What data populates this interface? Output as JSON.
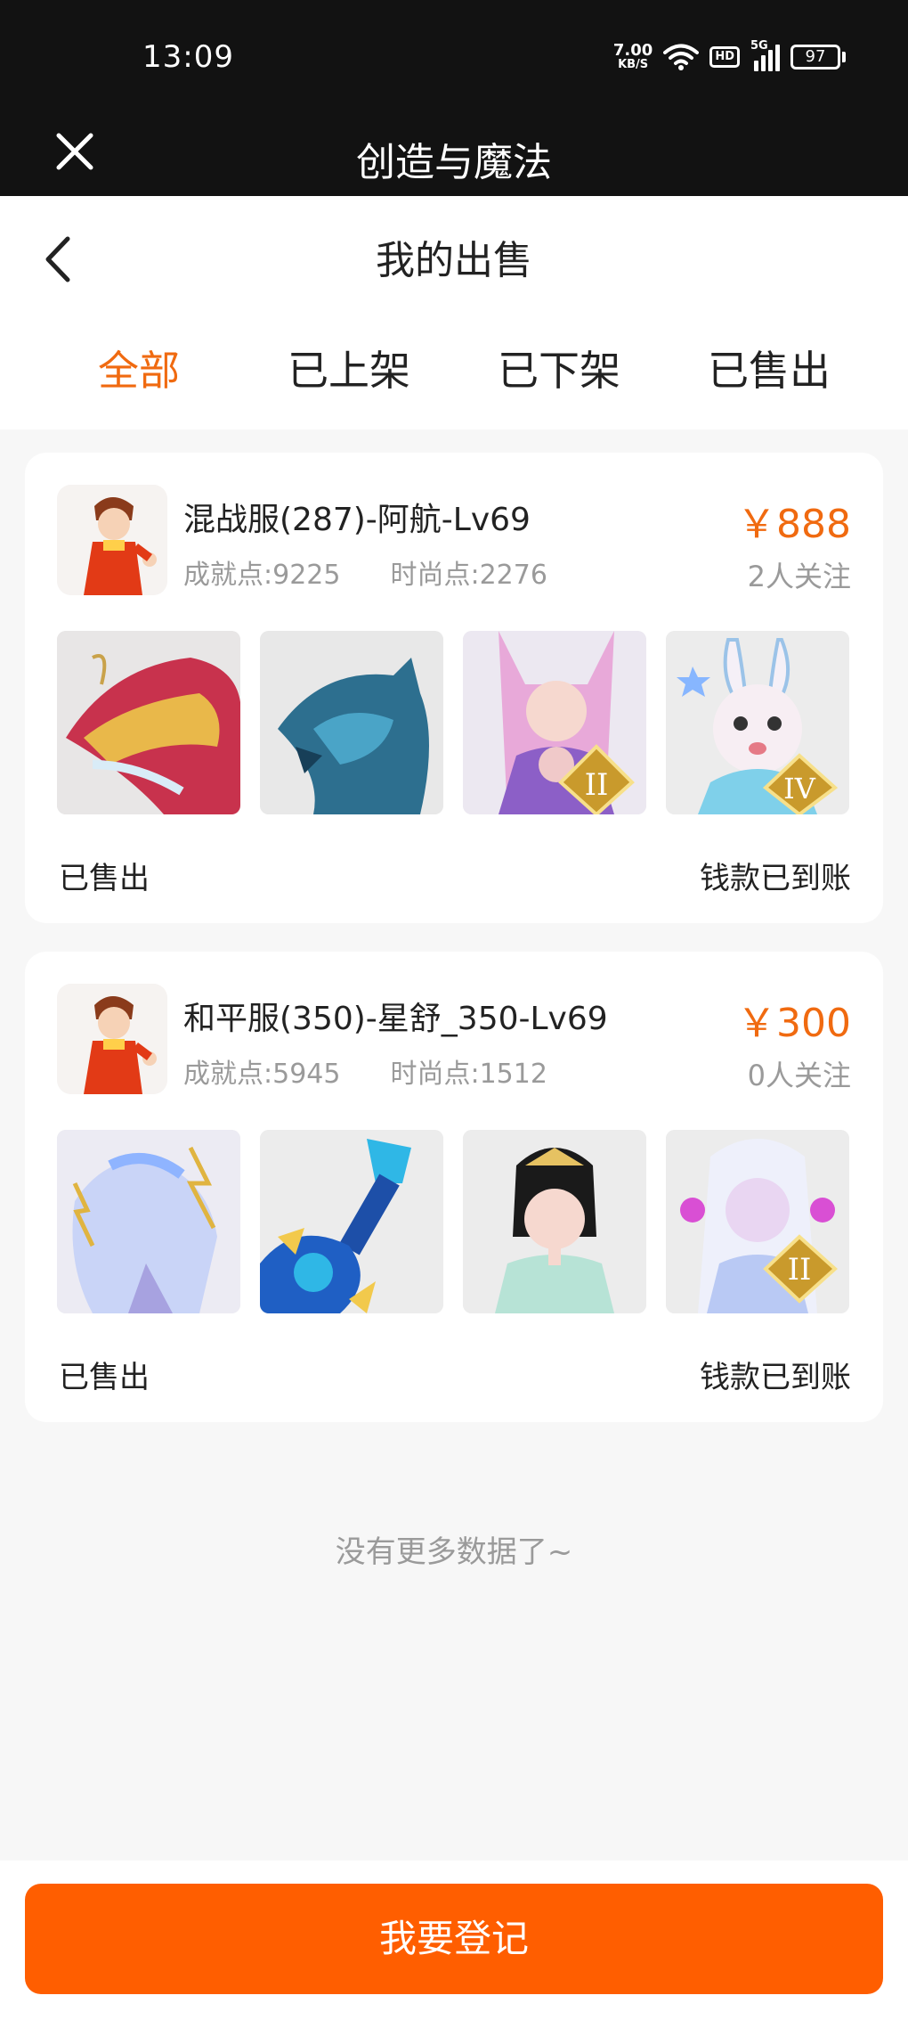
{
  "status_bar": {
    "time": "13:09",
    "net_speed_value": "7.00",
    "net_speed_unit": "KB/S",
    "hd_badge": "HD",
    "signal_label": "5G",
    "battery": "97"
  },
  "app_bar": {
    "title": "创造与魔法"
  },
  "page": {
    "title": "我的出售"
  },
  "tabs": [
    {
      "label": "全部",
      "active": true
    },
    {
      "label": "已上架",
      "active": false
    },
    {
      "label": "已下架",
      "active": false
    },
    {
      "label": "已售出",
      "active": false
    }
  ],
  "listings": [
    {
      "name": "混战服(287)-阿航-Lv69",
      "achievement": "成就点:9225",
      "fashion": "时尚点:2276",
      "price": "￥888",
      "followers": "2人关注",
      "thumbs": [
        "red-dragon",
        "ice-dragon",
        "fox-girl-rank-II",
        "bunny-rank-IV"
      ],
      "badges": [
        "",
        "",
        "II",
        "IV"
      ],
      "status": "已售出",
      "payment": "钱款已到账"
    },
    {
      "name": "和平服(350)-星舒_350-Lv69",
      "achievement": "成就点:5945",
      "fashion": "时尚点:1512",
      "price": "￥300",
      "followers": "0人关注",
      "thumbs": [
        "spirit-horse",
        "blue-guitar",
        "ancient-girl",
        "white-spirit-rank-II"
      ],
      "badges": [
        "",
        "",
        "",
        "II"
      ],
      "status": "已售出",
      "payment": "钱款已到账"
    }
  ],
  "no_more": "没有更多数据了~",
  "footer": {
    "button": "我要登记"
  },
  "colors": {
    "accent": "#f06a10",
    "button": "#ff5e00",
    "topbar": "#121212"
  }
}
